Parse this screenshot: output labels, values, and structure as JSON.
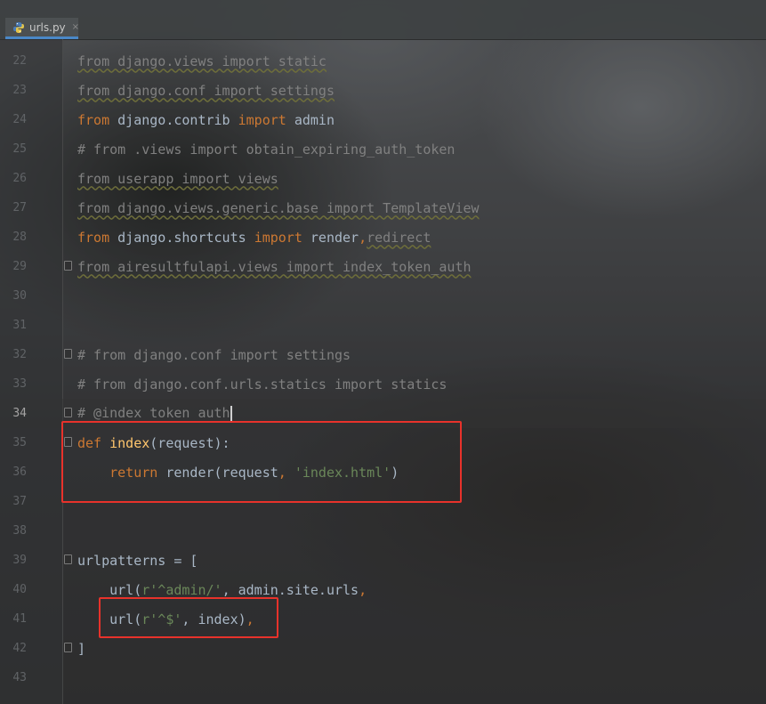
{
  "tab": {
    "filename": "urls.py",
    "icon": "python-file-icon"
  },
  "colors": {
    "keyword": "#cc7832",
    "function": "#ffc66d",
    "string": "#6a8759",
    "comment": "#808080",
    "text": "#a9b7c6",
    "line_number": "#606366",
    "highlight_box": "#e8322b"
  },
  "editor": {
    "current_line": 34,
    "lines": [
      {
        "num": "22",
        "text": "from django.views import static"
      },
      {
        "num": "23",
        "text": "from django.conf import settings"
      },
      {
        "num": "24",
        "kw1": "from",
        "mid": " django.contrib ",
        "kw2": "import",
        "tail": " admin"
      },
      {
        "num": "25",
        "text": "# from .views import obtain_expiring_auth_token"
      },
      {
        "num": "26",
        "text": "from userapp import views"
      },
      {
        "num": "27",
        "text": "from django.views.generic.base import TemplateView"
      },
      {
        "num": "28",
        "kw1": "from",
        "mid": " django.shortcuts ",
        "kw2": "import",
        "tail": " render",
        "comma": ",",
        "tail2": "redirect"
      },
      {
        "num": "29",
        "text": "from airesultfulapi.views import index_token_auth"
      },
      {
        "num": "30",
        "text": ""
      },
      {
        "num": "31",
        "text": ""
      },
      {
        "num": "32",
        "text": "# from django.conf import settings"
      },
      {
        "num": "33",
        "text": "# from django.conf.urls.statics import statics"
      },
      {
        "num": "34",
        "text": "# @index token auth"
      },
      {
        "num": "35",
        "kw": "def",
        "fname": "index",
        "rest": "(request):"
      },
      {
        "num": "36",
        "indent": "    ",
        "kw": "return",
        "call": " render(request",
        "comma": ",",
        "str": " 'index.html'",
        "end": ")"
      },
      {
        "num": "37",
        "text": ""
      },
      {
        "num": "38",
        "text": ""
      },
      {
        "num": "39",
        "text": "urlpatterns = ["
      },
      {
        "num": "40",
        "indent": "    ",
        "call": "url(",
        "str": "r'^admin/'",
        "rest": ", admin.site.urls",
        "comma": ","
      },
      {
        "num": "41",
        "indent": "    ",
        "call": "url(",
        "str": "r'^$'",
        "rest": ", index)",
        "comma": ","
      },
      {
        "num": "42",
        "text": "]"
      },
      {
        "num": "43",
        "text": ""
      }
    ]
  }
}
